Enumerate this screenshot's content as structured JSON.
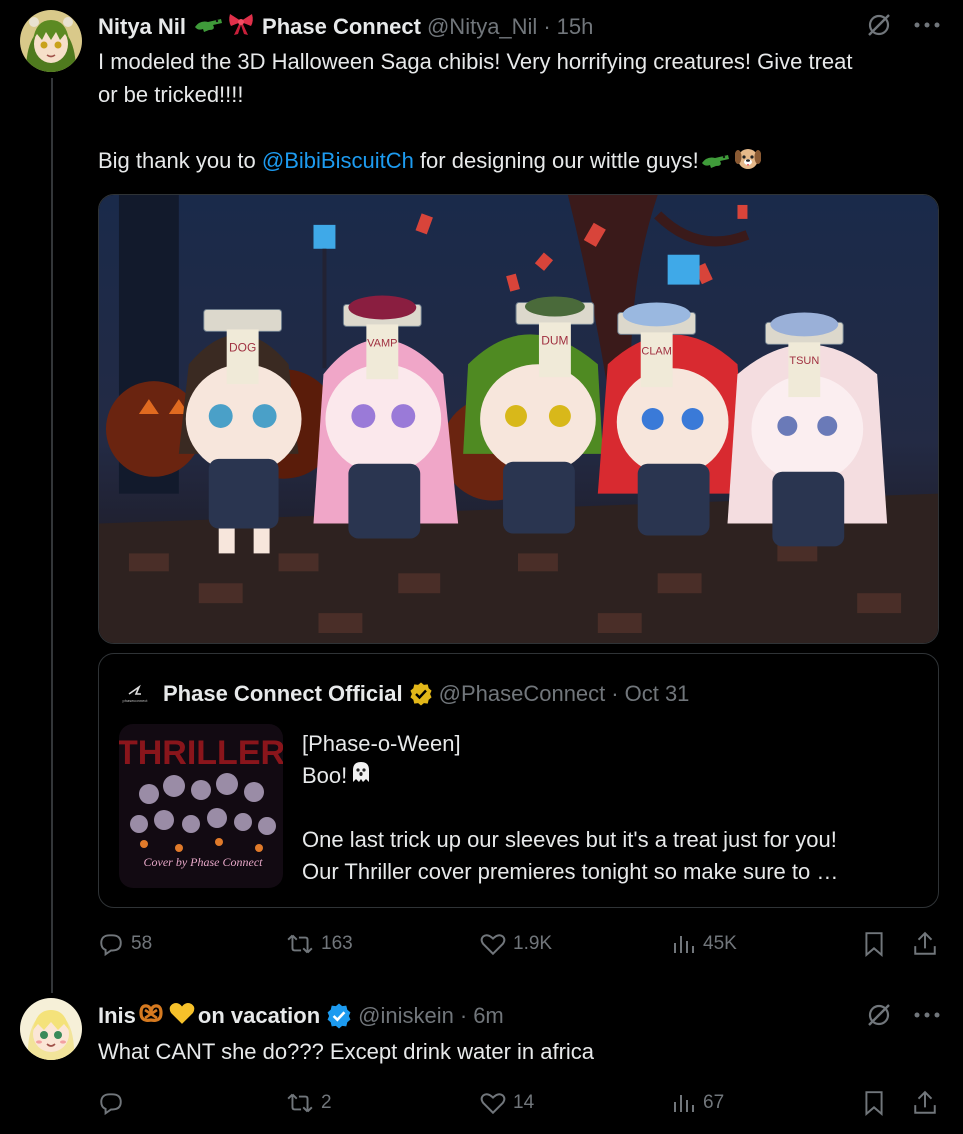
{
  "tweet": {
    "author_name": "Nitya Nil",
    "author_suffix": "Phase Connect",
    "handle": "@Nitya_Nil",
    "separator": "·",
    "time": "15h",
    "text_line1": "I modeled the 3D Halloween Saga chibis! Very horrifying creatures! Give treat",
    "text_line2": "or be tricked!!!!",
    "text_thanks_prefix": "Big thank you to ",
    "mention": "@BibiBiscuitCh",
    "text_thanks_suffix": " for designing our wittle guys!",
    "hat_labels": [
      "DOG",
      "VAMP",
      "DUM",
      "CLAM",
      "TSUN"
    ],
    "quote": {
      "name": "Phase Connect Official",
      "handle": "@PhaseConnect",
      "separator": "·",
      "date": "Oct 31",
      "logo_text": "phaseconnect",
      "thumb_caption": "Cover by Phase Connect",
      "line1": "[Phase-o-Ween]",
      "line2": "Boo!",
      "line3": "One last trick up our sleeves but it's a treat just for you!",
      "line4": "Our Thriller cover premieres tonight so make sure to …"
    },
    "stats": {
      "replies": "58",
      "reposts": "163",
      "likes": "1.9K",
      "views": "45K"
    }
  },
  "reply": {
    "author_prefix": "Inis",
    "author_suffix": "on vacation",
    "handle": "@iniskein",
    "separator": "·",
    "time": "6m",
    "text": "What CANT she do??? Except drink water in africa",
    "stats": {
      "replies": "",
      "reposts": "2",
      "likes": "14",
      "views": "67"
    }
  },
  "colors": {
    "background": "#000000",
    "text": "#e7e9ea",
    "muted": "#71767b",
    "link": "#1d9bf0",
    "border": "#2f3336",
    "verified_gold": "#e2b719",
    "verified_blue": "#1d9bf0"
  }
}
